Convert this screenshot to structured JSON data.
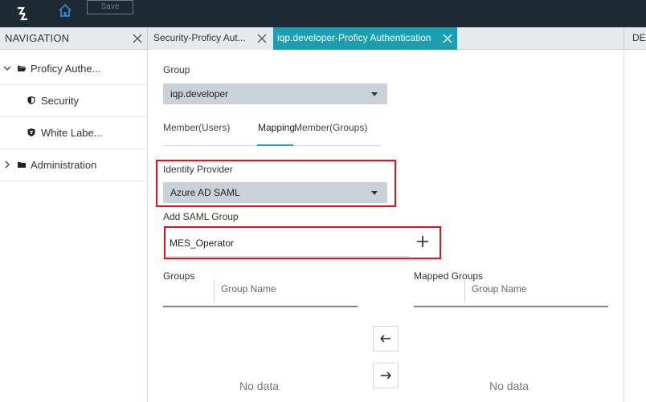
{
  "toolbar": {
    "save_label": "Save"
  },
  "navigation": {
    "title": "NAVIGATION",
    "items": [
      {
        "label": "Proficy Authe...",
        "icon": "folder-open-icon",
        "expanded": true
      },
      {
        "label": "Security",
        "icon": "shield-icon"
      },
      {
        "label": "White Labe...",
        "icon": "shield-brand-icon"
      },
      {
        "label": "Administration",
        "icon": "folder-icon",
        "expanded": false
      }
    ]
  },
  "tabs": [
    {
      "label": "Security-Proficy Aut...",
      "active": false
    },
    {
      "label": "iqp.developer-Proficy Authentication",
      "active": true
    }
  ],
  "right_tab": {
    "label": "DE"
  },
  "form": {
    "group_label": "Group",
    "group_value": "iqp.developer",
    "subtabs": [
      "Member(Users)",
      "Mapping",
      "Member(Groups)"
    ],
    "active_subtab": "Mapping",
    "identity_provider_label": "Identity Provider",
    "identity_provider_value": "Azure AD SAML",
    "add_saml_label": "Add SAML Group",
    "saml_group_value": "MES_Operator"
  },
  "groups": {
    "label": "Groups",
    "column": "Group Name",
    "empty_text": "No data"
  },
  "mapped_groups": {
    "label": "Mapped Groups",
    "column": "Group Name",
    "empty_text": "No data"
  },
  "colors": {
    "accent": "#1a9eb0",
    "topbar": "#1d2a33",
    "highlight": "#e0121c",
    "select_bg": "#c9d2d8"
  }
}
